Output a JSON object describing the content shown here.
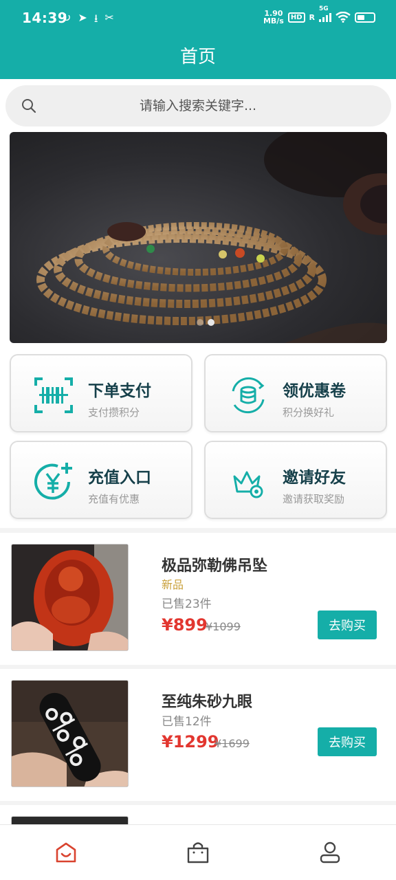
{
  "status_bar": {
    "time": "14:39",
    "net_speed_value": "1.90",
    "net_speed_unit": "MB/s",
    "hd_label": "HD",
    "network": "5G",
    "roaming": "R"
  },
  "header": {
    "title": "首页"
  },
  "search": {
    "placeholder": "请输入搜索关键字..."
  },
  "banner": {
    "slide_count": 2,
    "active_index": 1
  },
  "quick_actions": [
    {
      "title": "下单支付",
      "subtitle": "支付攒积分",
      "icon": "barcode-scan-icon"
    },
    {
      "title": "领优惠卷",
      "subtitle": "积分换好礼",
      "icon": "coin-exchange-icon"
    },
    {
      "title": "充值入口",
      "subtitle": "充值有优惠",
      "icon": "yuan-plus-icon"
    },
    {
      "title": "邀请好友",
      "subtitle": "邀请获取奖励",
      "icon": "crown-invite-icon"
    }
  ],
  "products": [
    {
      "name": "极品弥勒佛吊坠",
      "tag": "新品",
      "sold": "已售23件",
      "price": "¥899",
      "original_price": "¥1099",
      "button": "去购买"
    },
    {
      "name": "至纯朱砂九眼",
      "tag": "",
      "sold": "已售12件",
      "price": "¥1299",
      "original_price": "¥1699",
      "button": "去购买"
    }
  ],
  "tabbar": {
    "active": "home",
    "items": [
      "home-icon",
      "shopping-bag-icon",
      "user-icon"
    ]
  },
  "colors": {
    "primary": "#15aea8",
    "price": "#e2362f",
    "tag": "#c9a03a",
    "active_tab": "#d9432f",
    "card_title": "#16404a"
  }
}
